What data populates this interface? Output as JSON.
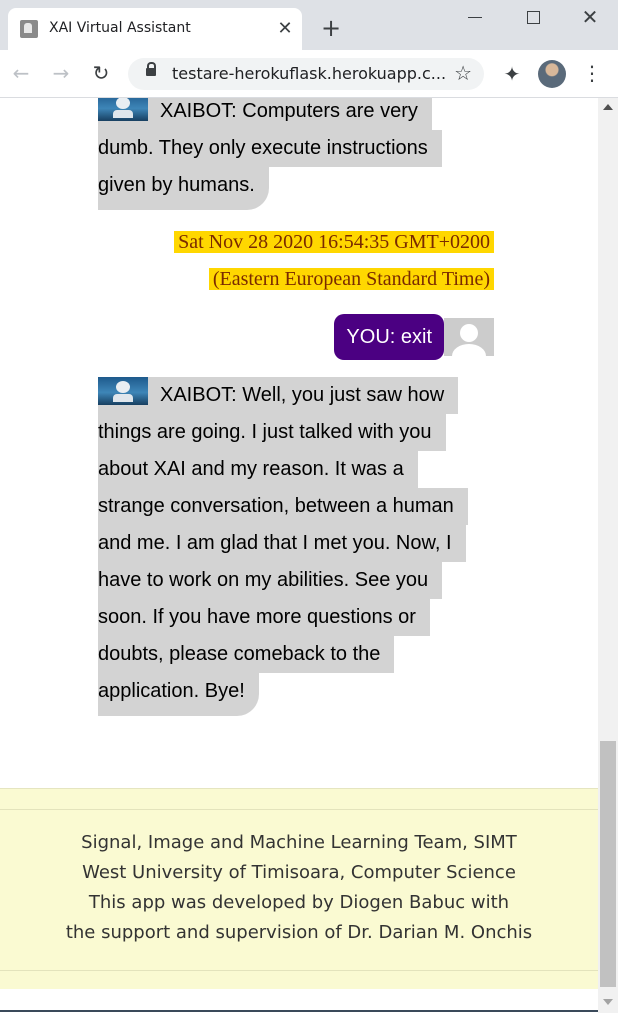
{
  "browser": {
    "tab_title": "XAI Virtual Assistant",
    "url": "testare-herokuflask.herokuapp.c...",
    "icons": {
      "favicon": "robot-favicon-icon",
      "close": "close-icon",
      "new_tab": "plus-icon",
      "back": "arrow-left-icon",
      "forward": "arrow-right-icon",
      "reload": "reload-icon",
      "lock": "lock-icon",
      "bookmark": "star-icon",
      "extensions": "puzzle-icon",
      "profile": "profile-avatar",
      "menu": "kebab-menu-icon"
    }
  },
  "chat": {
    "bot_message_1": {
      "lines": [
        "XAIBOT: Computers are very",
        "dumb. They only execute instructions",
        "given by humans."
      ]
    },
    "timestamp": {
      "lines": [
        "Sat Nov 28 2020 16:54:35 GMT+0200",
        "(Eastern European Standard Time)"
      ]
    },
    "user_message": "YOU: exit",
    "bot_message_2": {
      "lines": [
        "XAIBOT: Well, you just saw how",
        "things are going. I just talked with you",
        "about XAI and my reason. It was a",
        "strange conversation, between a human",
        "and me. I am glad that I met you. Now, I",
        "have to work on my abilities. See you",
        "soon. If you have more questions or",
        "doubts, please comeback to the",
        "application. Bye!"
      ]
    }
  },
  "footer": {
    "lines": [
      "Signal, Image and Machine Learning Team, SIMT",
      "West University of Timisoara, Computer Science",
      "This app was developed by Diogen Babuc with",
      "the support and supervision of Dr. Darian M. Onchis"
    ]
  },
  "colors": {
    "bot_bubble": "#d3d3d3",
    "user_bubble": "#4b0082",
    "timestamp_bg": "#ffd700",
    "timestamp_text": "#7a2a00",
    "footer_bg": "#fafad2"
  }
}
